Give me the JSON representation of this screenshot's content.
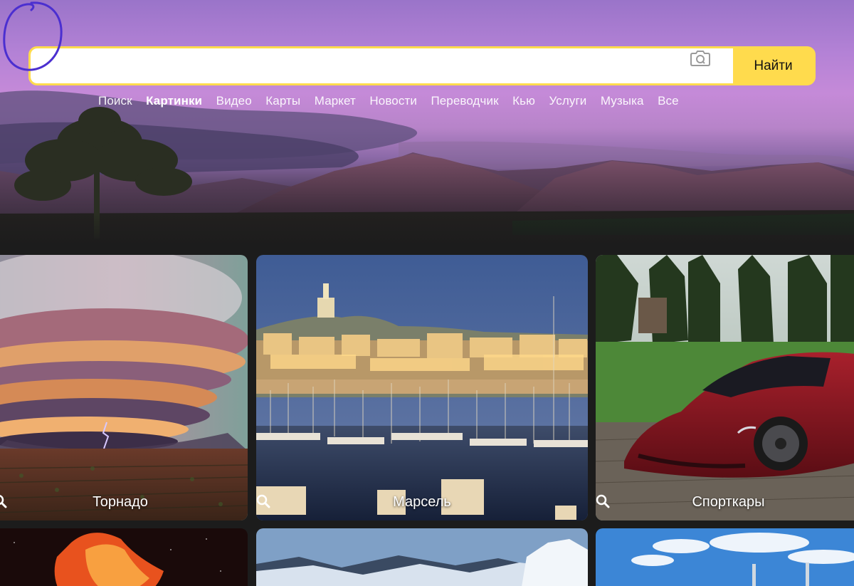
{
  "search": {
    "value": "",
    "placeholder": "",
    "submit_label": "Найти"
  },
  "services": [
    {
      "label": "Поиск",
      "active": false
    },
    {
      "label": "Картинки",
      "active": true
    },
    {
      "label": "Видео",
      "active": false
    },
    {
      "label": "Карты",
      "active": false
    },
    {
      "label": "Маркет",
      "active": false
    },
    {
      "label": "Новости",
      "active": false
    },
    {
      "label": "Переводчик",
      "active": false
    },
    {
      "label": "Кью",
      "active": false
    },
    {
      "label": "Услуги",
      "active": false
    },
    {
      "label": "Музыка",
      "active": false
    },
    {
      "label": "Все",
      "active": false
    }
  ],
  "tiles": [
    {
      "label": "Торнадо",
      "icon": "search-icon"
    },
    {
      "label": "Марсель",
      "icon": "search-icon"
    },
    {
      "label": "Спорткары",
      "icon": "search-icon"
    }
  ],
  "colors": {
    "accent": "#ffdb4d",
    "annotation": "#4b2fd0"
  }
}
